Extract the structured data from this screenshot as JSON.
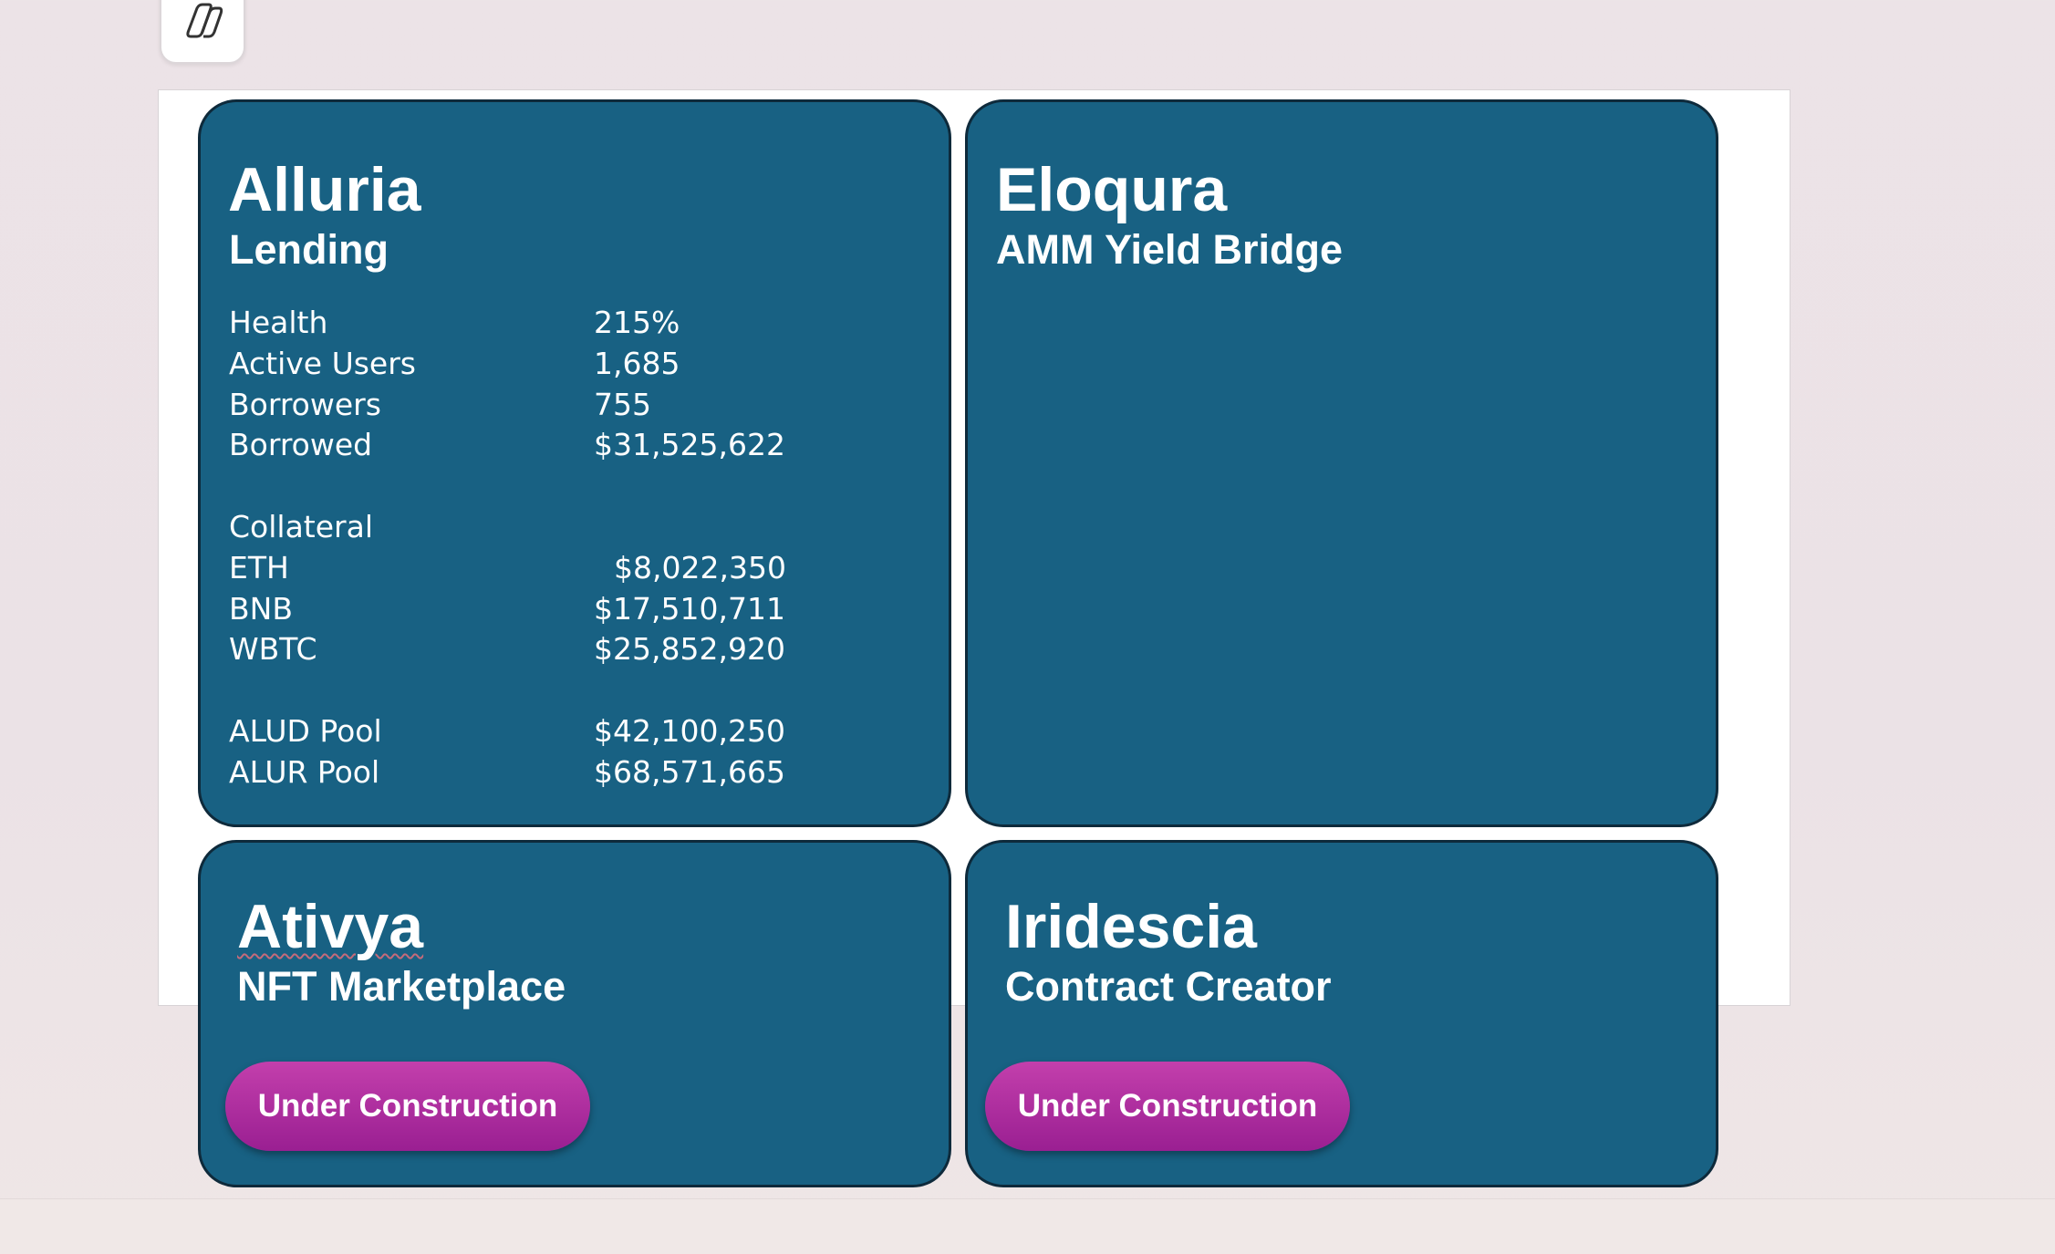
{
  "toolbar": {
    "copilot_icon": "copilot-icon"
  },
  "cards": {
    "alluria": {
      "title": "Alluria",
      "subtitle": "Lending",
      "stats": [
        {
          "label": "Health",
          "value": "215%"
        },
        {
          "label": "Active Users",
          "value": "1,685"
        },
        {
          "label": "Borrowers",
          "value": "755"
        },
        {
          "label": "Borrowed",
          "value": "$31,525,622"
        }
      ],
      "collateral_heading": "Collateral",
      "collateral": [
        {
          "label": "ETH",
          "value": "$8,022,350"
        },
        {
          "label": "BNB",
          "value": "$17,510,711"
        },
        {
          "label": "WBTC",
          "value": "$25,852,920"
        }
      ],
      "pools": [
        {
          "label": "ALUD Pool",
          "value": "$42,100,250"
        },
        {
          "label": "ALUR Pool",
          "value": "$68,571,665"
        }
      ]
    },
    "eloqura": {
      "title": "Eloqura",
      "subtitle": "AMM Yield Bridge"
    },
    "ativya": {
      "title": "Ativya",
      "subtitle": "NFT Marketplace",
      "button_label": "Under Construction"
    },
    "iridescia": {
      "title": "Iridescia",
      "subtitle": "Contract Creator",
      "button_label": "Under Construction"
    }
  },
  "colors": {
    "card_background": "#186183",
    "card_border": "#0e2a3b",
    "button_gradient_top": "#c33fac",
    "button_gradient_bottom": "#9a1f92",
    "text": "#ffffff"
  }
}
